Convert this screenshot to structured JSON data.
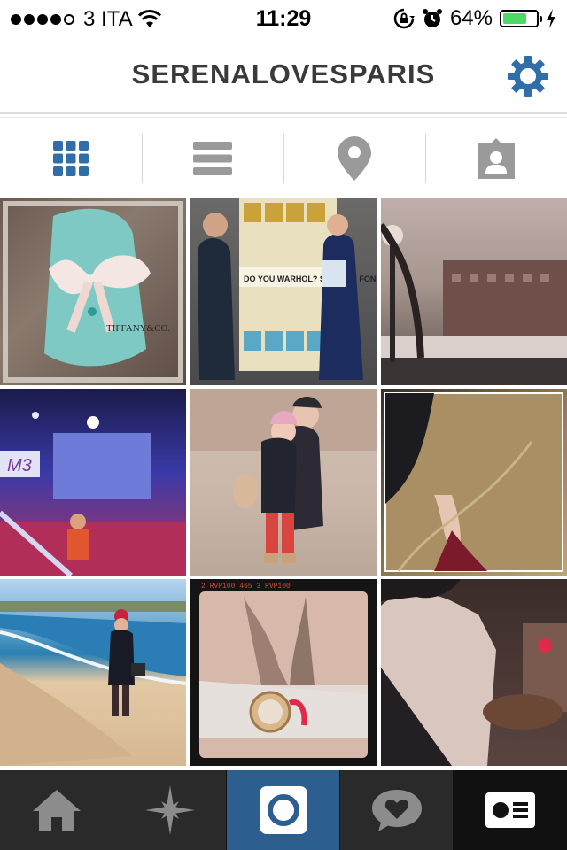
{
  "status_bar": {
    "carrier": "3 ITA",
    "time": "11:29",
    "battery": "64%",
    "battery_level": 0.64
  },
  "header": {
    "username": "SERENALOVESPARIS",
    "settings_icon": "gear-icon"
  },
  "tabs": [
    {
      "icon": "grid-icon",
      "active": true
    },
    {
      "icon": "list-icon",
      "active": false
    },
    {
      "icon": "location-pin-icon",
      "active": false
    },
    {
      "icon": "tagged-photos-icon",
      "active": false
    }
  ],
  "photos": [
    {
      "label": "TIFFANY&CO."
    },
    {
      "label": "DO YOU WARHOL? SOSTIENI FONDAZIONE FIBROSI CISTICA"
    },
    {
      "label": ""
    },
    {
      "label": "M3"
    },
    {
      "label": ""
    },
    {
      "label": ""
    },
    {
      "label": ""
    },
    {
      "label": "2 RVP100 465 3 RVP100"
    },
    {
      "label": ""
    }
  ],
  "bottom_nav": [
    {
      "icon": "home-icon",
      "active": false
    },
    {
      "icon": "explore-icon",
      "active": false
    },
    {
      "icon": "camera-icon",
      "active": true
    },
    {
      "icon": "activity-icon",
      "active": false
    },
    {
      "icon": "profile-icon",
      "active": false
    }
  ],
  "colors": {
    "accent": "#2c5f8f",
    "icon_active": "#2f6ea8",
    "icon_inactive": "#9a9a9a",
    "title": "#3a3a3a"
  }
}
